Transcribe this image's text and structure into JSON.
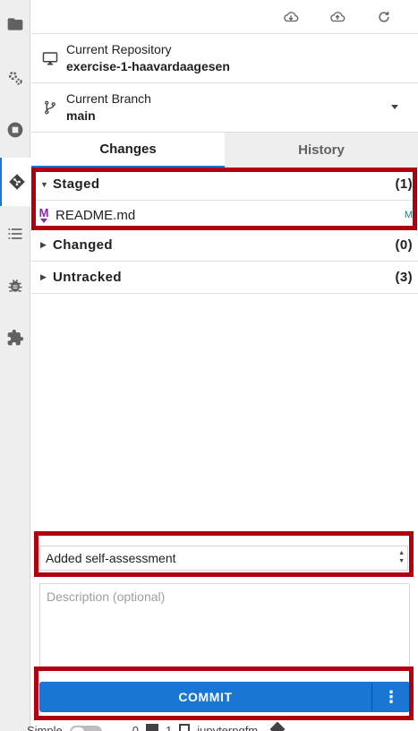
{
  "activity_bar": {
    "items": [
      {
        "name": "folder-icon"
      },
      {
        "name": "running-icon"
      },
      {
        "name": "stop-icon"
      },
      {
        "name": "git-icon",
        "active": true
      },
      {
        "name": "list-icon"
      },
      {
        "name": "debug-icon"
      },
      {
        "name": "extension-icon"
      }
    ]
  },
  "toolbar": {
    "buttons": [
      "cloud-pull-icon",
      "cloud-push-icon",
      "refresh-icon"
    ]
  },
  "repository": {
    "label": "Current Repository",
    "value": "exercise-1-haavardaagesen"
  },
  "branch": {
    "label": "Current Branch",
    "value": "main"
  },
  "tabs": [
    {
      "label": "Changes",
      "active": true
    },
    {
      "label": "History",
      "active": false
    }
  ],
  "sections": {
    "staged": {
      "title": "Staged",
      "count": "(1)",
      "expanded": true,
      "files": [
        {
          "name": "README.md",
          "status": "M",
          "icon": "markdown-icon"
        }
      ]
    },
    "changed": {
      "title": "Changed",
      "count": "(0)",
      "expanded": false
    },
    "untracked": {
      "title": "Untracked",
      "count": "(3)",
      "expanded": false
    }
  },
  "commit": {
    "summary_value": "Added self-assessment",
    "description_placeholder": "Description (optional)",
    "button_label": "COMMIT",
    "more_label": "⋮"
  },
  "status_bar": {
    "mode_label": "Simple",
    "count_a": "0",
    "count_b": "1",
    "kernel": "jupyterpgfm"
  },
  "colors": {
    "accent": "#1976d2",
    "highlight": "#b00010",
    "markdown": "#8e24aa",
    "modified_status": "#00838f"
  }
}
